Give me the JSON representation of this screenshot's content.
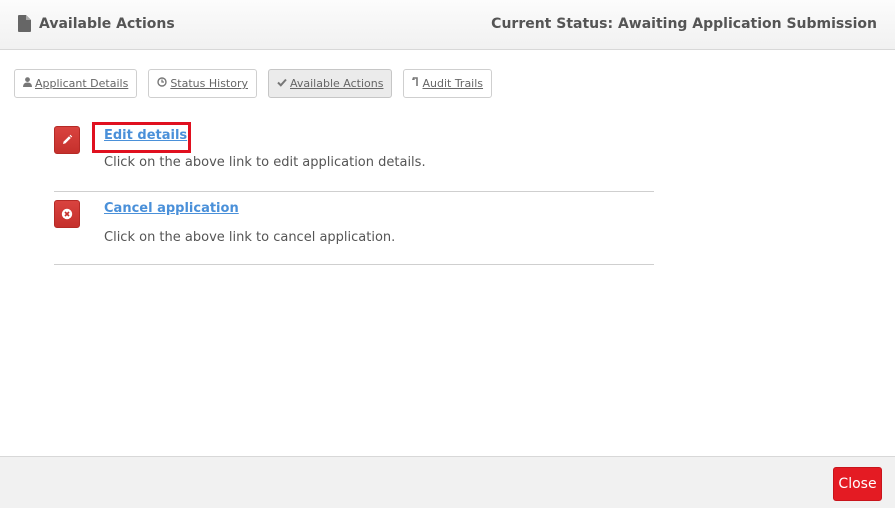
{
  "header": {
    "title": "Available Actions",
    "status": "Current Status: Awaiting Application Submission",
    "icon": "document-icon"
  },
  "tabs": [
    {
      "label": "Applicant Details",
      "icon": "user-icon",
      "active": false
    },
    {
      "label": "Status History",
      "icon": "clock-icon",
      "active": false
    },
    {
      "label": "Available Actions",
      "icon": "check-icon",
      "active": true
    },
    {
      "label": "Audit Trails",
      "icon": "history-icon",
      "active": false
    }
  ],
  "actions": [
    {
      "link": "Edit details",
      "description": "Click on the above link to edit application details.",
      "icon": "pencil-icon"
    },
    {
      "link": "Cancel application",
      "description": "Click on the above link to cancel application.",
      "icon": "cancel-icon"
    }
  ],
  "footer": {
    "close_label": "Close"
  },
  "colors": {
    "accent_red": "#e41b23",
    "link_blue": "#4a90d9",
    "action_icon_red": "#d03a36"
  }
}
